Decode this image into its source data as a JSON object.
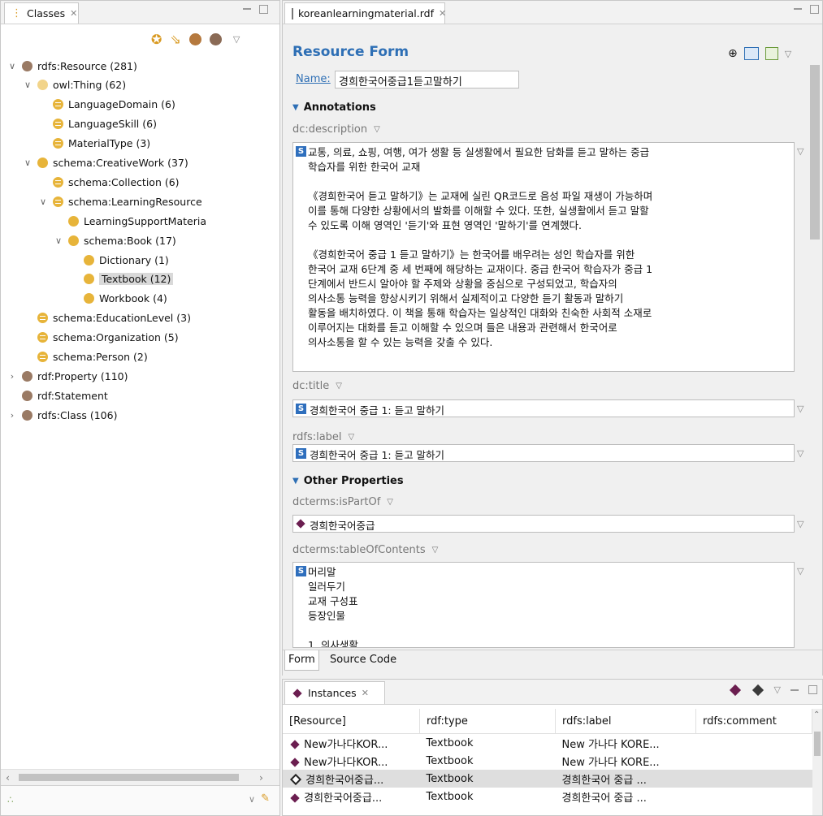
{
  "classes": {
    "tab_label": "Classes",
    "tree": [
      {
        "label": "rdfs:Resource",
        "count": "(281)",
        "depth": 0,
        "arrow": "down",
        "icon": "brown"
      },
      {
        "label": "owl:Thing",
        "count": "(62)",
        "depth": 1,
        "arrow": "down",
        "icon": "lightyellow"
      },
      {
        "label": "LanguageDomain",
        "count": "(6)",
        "depth": 2,
        "arrow": "none",
        "icon": "eq"
      },
      {
        "label": "LanguageSkill",
        "count": "(6)",
        "depth": 2,
        "arrow": "none",
        "icon": "eq"
      },
      {
        "label": "MaterialType",
        "count": "(3)",
        "depth": 2,
        "arrow": "none",
        "icon": "eq"
      },
      {
        "label": "schema:CreativeWork",
        "count": "(37)",
        "depth": 1,
        "arrow": "down",
        "icon": "yellow"
      },
      {
        "label": "schema:Collection",
        "count": "(6)",
        "depth": 2,
        "arrow": "none",
        "icon": "eq"
      },
      {
        "label": "schema:LearningResource",
        "count": "",
        "depth": 2,
        "arrow": "down",
        "icon": "eq"
      },
      {
        "label": "LearningSupportMateria",
        "count": "",
        "depth": 3,
        "arrow": "none",
        "icon": "yellow"
      },
      {
        "label": "schema:Book",
        "count": "(17)",
        "depth": 3,
        "arrow": "down",
        "icon": "yellow"
      },
      {
        "label": "Dictionary",
        "count": "(1)",
        "depth": 4,
        "arrow": "none",
        "icon": "yellow"
      },
      {
        "label": "Textbook",
        "count": "(12)",
        "depth": 4,
        "arrow": "none",
        "icon": "yellow",
        "selected": true
      },
      {
        "label": "Workbook",
        "count": "(4)",
        "depth": 4,
        "arrow": "none",
        "icon": "yellow"
      },
      {
        "label": "schema:EducationLevel",
        "count": "(3)",
        "depth": 1,
        "arrow": "none",
        "icon": "eq"
      },
      {
        "label": "schema:Organization",
        "count": "(5)",
        "depth": 1,
        "arrow": "none",
        "icon": "eq"
      },
      {
        "label": "schema:Person",
        "count": "(2)",
        "depth": 1,
        "arrow": "none",
        "icon": "eq"
      },
      {
        "label": "rdf:Property",
        "count": "(110)",
        "depth": 0,
        "arrow": "right",
        "icon": "brown"
      },
      {
        "label": "rdf:Statement",
        "count": "",
        "depth": 0,
        "arrow": "none",
        "icon": "brown"
      },
      {
        "label": "rdfs:Class",
        "count": "(106)",
        "depth": 0,
        "arrow": "right",
        "icon": "brown"
      }
    ]
  },
  "editor": {
    "tab_label": "koreanlearningmaterial.rdf",
    "form_title": "Resource Form",
    "name_label": "Name:",
    "name_value": "경희한국어중급1듣고말하기",
    "annotations_header": "Annotations",
    "description_label": "dc:description",
    "description_value": "교통, 의료, 쇼핑, 여행, 여가 생활 등 실생활에서 필요한 담화를 듣고 말하는 중급\n학습자를 위한 한국어 교재\n\n《경희한국어 듣고 말하기》는 교재에 실린 QR코드로 음성 파일 재생이 가능하며\n이를 통해 다양한 상황에서의 발화를 이해할 수 있다. 또한, 실생활에서 듣고 말할\n수 있도록 이해 영역인 '듣기'와 표현 영역인 '말하기'를 연계했다.\n\n《경희한국어 중급 1 듣고 말하기》는 한국어를 배우려는 성인 학습자를 위한\n한국어 교재 6단계 중 세 번째에 해당하는 교재이다. 중급 한국어 학습자가 중급 1\n단계에서 반드시 알아야 할 주제와 상황을 중심으로 구성되었고, 학습자의\n의사소통 능력을 향상시키기 위해서 실제적이고 다양한 듣기 활동과 말하기\n활동을 배치하였다. 이 책을 통해 학습자는 일상적인 대화와 친숙한 사회적 소재로\n이루어지는 대화를 듣고 이해할 수 있으며 들은 내용과 관련해서 한국어로\n의사소통을 할 수 있는 능력을 갖출 수 있다.",
    "title_label": "dc:title",
    "title_value": "경희한국어 중급 1: 듣고 말하기",
    "rdfs_label_label": "rdfs:label",
    "rdfs_label_value": "경희한국어 중급 1: 듣고 말하기",
    "other_header": "Other Properties",
    "ispartof_label": "dcterms:isPartOf",
    "ispartof_value": "경희한국어중급",
    "toc_label": "dcterms:tableOfContents",
    "toc_value": "머리말\n일러두기\n교재 구성표\n등장인물\n\n1. 의사생활",
    "bottom_tabs": [
      "Form",
      "Source Code"
    ],
    "s_badge": "S"
  },
  "instances": {
    "tab_label": "Instances",
    "columns": [
      "[Resource]",
      "rdf:type",
      "rdfs:label",
      "rdfs:comment"
    ],
    "rows": [
      [
        "New가나다KOR...",
        "Textbook",
        "New 가나다 KORE...",
        ""
      ],
      [
        "New가나다KOR...",
        "Textbook",
        "New 가나다 KORE...",
        ""
      ],
      [
        "경희한국어중급...",
        "Textbook",
        "경희한국어 중급 ...",
        ""
      ],
      [
        "경희한국어중급...",
        "Textbook",
        "경희한국어 중급 ...",
        ""
      ]
    ],
    "selected_row": 2
  },
  "colors": {
    "accent": "#2e6fb5",
    "instance_diamond": "#6b1e50",
    "selection": "#d9d9d9"
  }
}
